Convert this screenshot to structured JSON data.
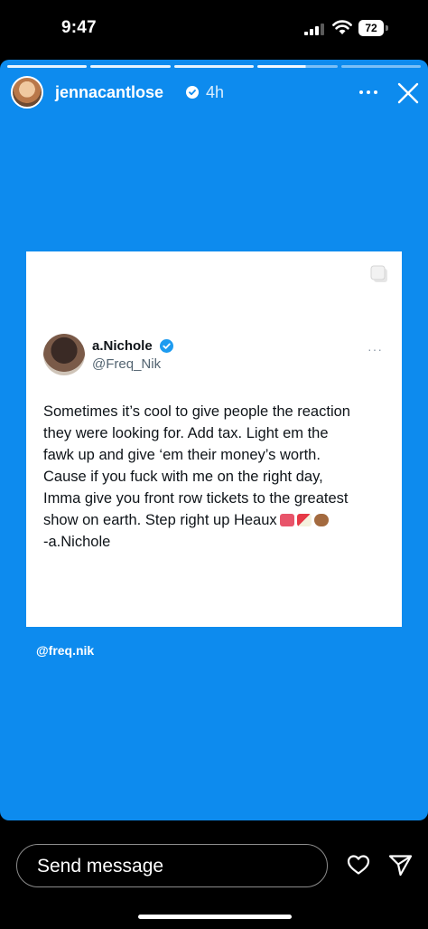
{
  "status_bar": {
    "time": "9:47",
    "battery": "72"
  },
  "story": {
    "background_color": "#0d8bee",
    "progress_segments": 5,
    "username": "jennacantlose",
    "time_ago": "4h",
    "icons": [
      "more-icon",
      "close-icon",
      "verified-icon"
    ]
  },
  "tweet": {
    "display_name": "a.Nichole",
    "handle": "@Freq_Nik",
    "text_lines": [
      "Sometimes it’s cool to give people the reaction",
      "they were looking for. Add tax. Light em the",
      "fawk up and give ‘em their money’s worth.",
      "Cause if you fuck with me on the right day,",
      "Imma give you front row tickets to the greatest",
      "show on earth. Step right up Heaux",
      "-a.Nichole"
    ],
    "emoji": [
      "ticket-emoji",
      "circus-tent-emoji",
      "clapping-hands-emoji"
    ],
    "more": "···"
  },
  "mention": "@freq.nik",
  "bottom_bar": {
    "message_placeholder": "Send message",
    "icons": [
      "heart-icon",
      "send-icon"
    ]
  }
}
